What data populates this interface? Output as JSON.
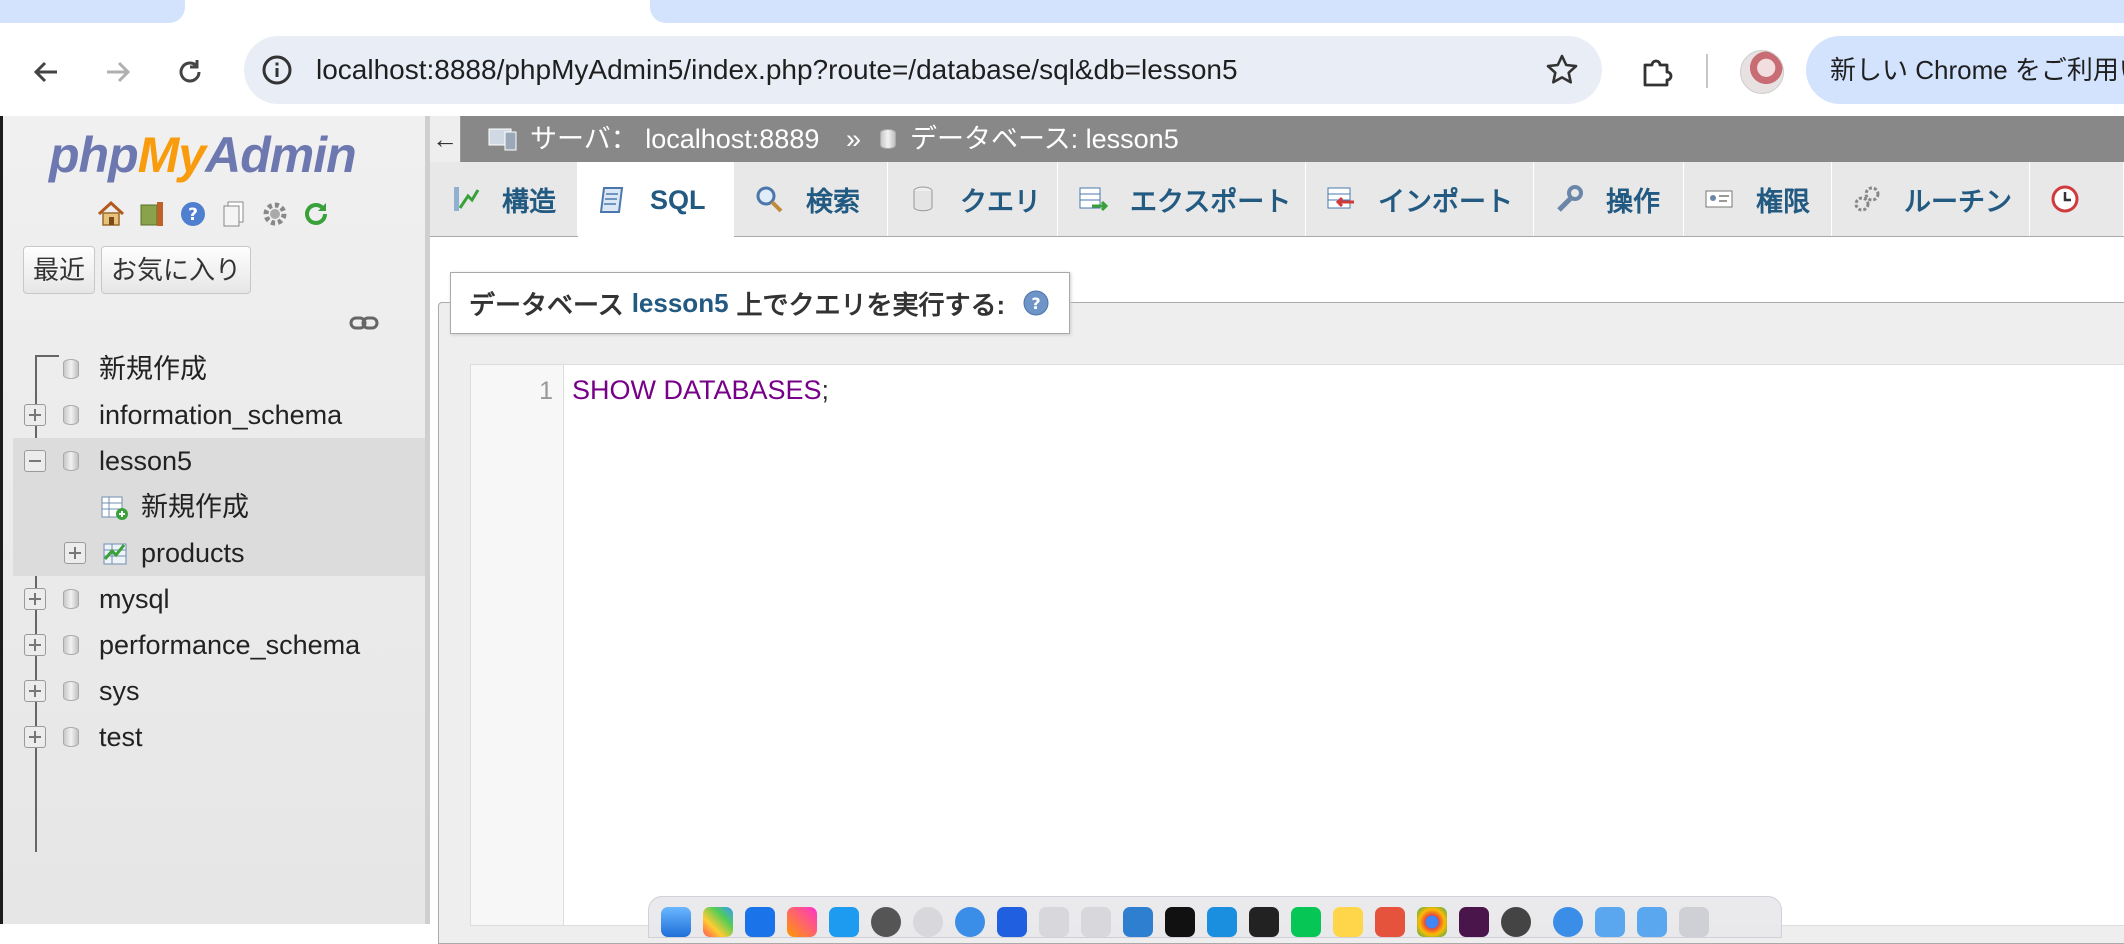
{
  "browser": {
    "url": "localhost:8888/phpMyAdmin5/index.php?route=/database/sql&db=lesson5",
    "promo_text": "新しい Chrome をご利用い"
  },
  "nav": {
    "logo": {
      "php": "php",
      "my": "My",
      "admin": "Admin"
    },
    "recent_label": "最近",
    "favorites_label": "お気に入り",
    "tree": [
      {
        "label": "新規作成"
      },
      {
        "label": "information_schema"
      },
      {
        "label": "lesson5"
      },
      {
        "label": "新規作成"
      },
      {
        "label": "products"
      },
      {
        "label": "mysql"
      },
      {
        "label": "performance_schema"
      },
      {
        "label": "sys"
      },
      {
        "label": "test"
      }
    ]
  },
  "breadcrumb": {
    "back": "←",
    "server_label": "サーバ： localhost:8889",
    "sep": "»",
    "database_label": "データベース: lesson5"
  },
  "tabs": [
    {
      "label": "構造",
      "icon": "structure-icon"
    },
    {
      "label": "SQL",
      "icon": "sql-icon"
    },
    {
      "label": "検索",
      "icon": "search-icon"
    },
    {
      "label": "クエリ",
      "icon": "query-icon"
    },
    {
      "label": "エクスポート",
      "icon": "export-icon"
    },
    {
      "label": "インポート",
      "icon": "import-icon"
    },
    {
      "label": "操作",
      "icon": "wrench-icon"
    },
    {
      "label": "権限",
      "icon": "privileges-icon"
    },
    {
      "label": "ルーチン",
      "icon": "routines-icon"
    }
  ],
  "active_tab": "SQL",
  "query": {
    "legend_prefix": "データベース",
    "legend_db": "lesson5",
    "legend_suffix": "上でクエリを実行する:",
    "line_number": "1",
    "code_keyword": "SHOW DATABASES",
    "code_punct": ";"
  },
  "colors": {
    "link": "#235a81",
    "sql_keyword": "#770088",
    "server_bar": "#888888",
    "chrome_tab": "#d3e3fd"
  }
}
